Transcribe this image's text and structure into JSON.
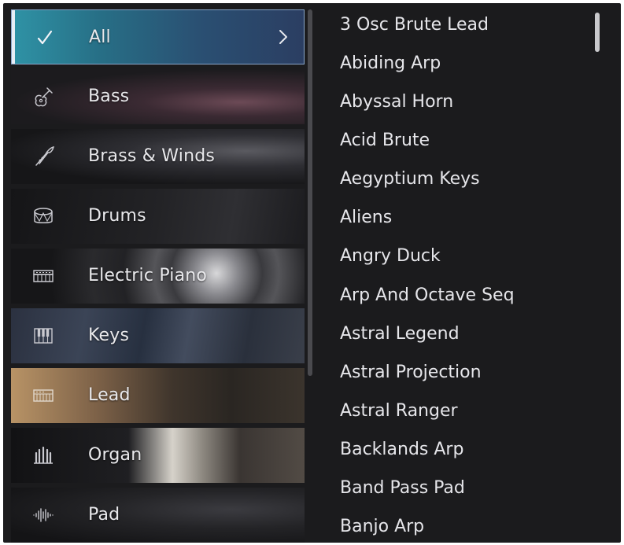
{
  "categories": [
    {
      "label": "All",
      "icon": "checkmark-icon",
      "selected": true
    },
    {
      "label": "Bass",
      "icon": "guitar-icon"
    },
    {
      "label": "Brass & Winds",
      "icon": "trumpet-icon"
    },
    {
      "label": "Drums",
      "icon": "drum-icon"
    },
    {
      "label": "Electric Piano",
      "icon": "electric-piano-icon"
    },
    {
      "label": "Keys",
      "icon": "piano-keys-icon"
    },
    {
      "label": "Lead",
      "icon": "synth-keyboard-icon"
    },
    {
      "label": "Organ",
      "icon": "organ-pipes-icon"
    },
    {
      "label": "Pad",
      "icon": "waveform-icon"
    }
  ],
  "presets": [
    "3 Osc Brute Lead",
    "Abiding Arp",
    "Abyssal Horn",
    "Acid Brute",
    "Aegyptium Keys",
    "Aliens",
    "Angry Duck",
    "Arp And Octave Seq",
    "Astral Legend",
    "Astral Projection",
    "Astral Ranger",
    "Backlands Arp",
    "Band Pass Pad",
    "Banjo Arp"
  ],
  "colors": {
    "panel_bg": "#1b1b1d",
    "text": "#e6e6ea",
    "selected_border": "#8aa6c9",
    "selected_accent": "#e8eef6"
  }
}
